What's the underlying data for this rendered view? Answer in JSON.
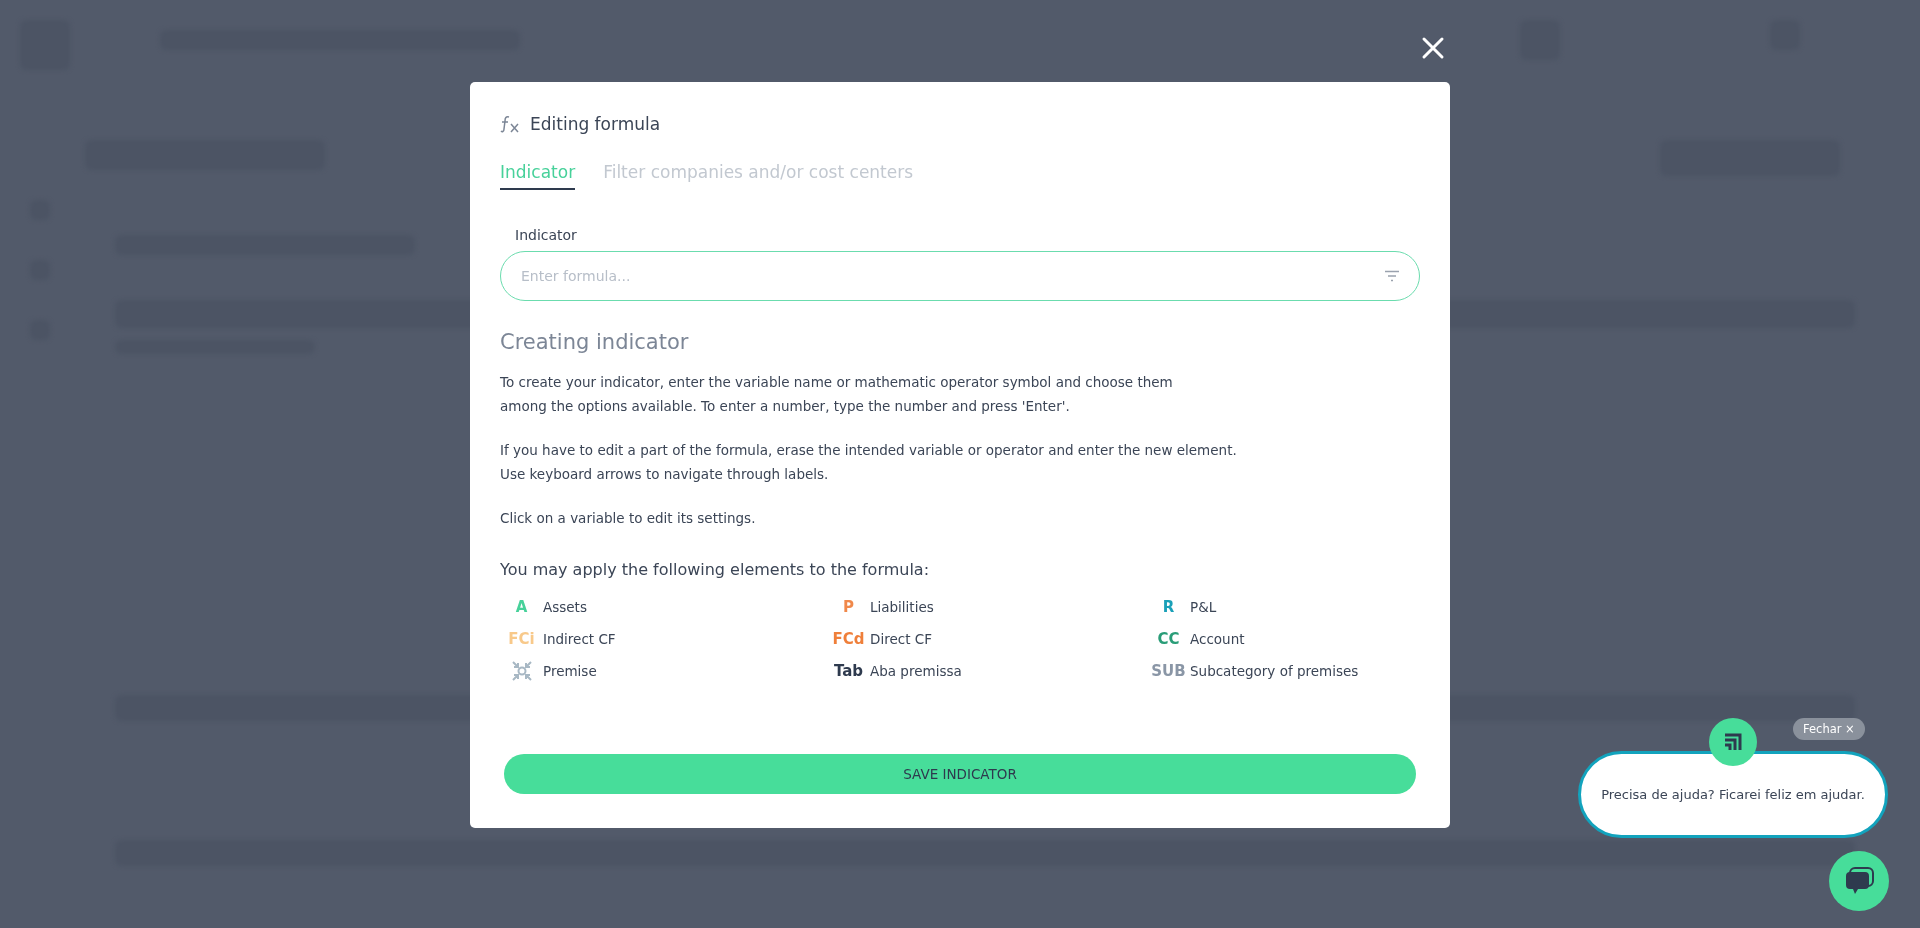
{
  "dialog": {
    "title": "Editing formula",
    "tabs": [
      {
        "label": "Indicator",
        "selected": true
      },
      {
        "label": "Filter companies and/or cost centers",
        "selected": false
      }
    ],
    "field": {
      "label": "Indicator",
      "placeholder": "Enter formula..."
    },
    "heading": "Creating indicator",
    "paragraphs": [
      [
        "To create your indicator, enter the variable name or mathematic operator symbol and choose them",
        "among the options available. To enter a number, type the number and press 'Enter'."
      ],
      [
        "If you have to edit a part of the formula, erase the intended variable or operator and enter the new element.",
        "Use keyboard arrows to navigate through labels."
      ],
      [
        "Click on a variable to edit its settings."
      ]
    ],
    "elements_title": "You may apply the following elements to the formula:",
    "elements": [
      {
        "kind": "text",
        "symbol": "A",
        "label": "Assets",
        "color": "#47d19a"
      },
      {
        "kind": "text",
        "symbol": "P",
        "label": "Liabilities",
        "color": "#f0884a"
      },
      {
        "kind": "text",
        "symbol": "R",
        "label": "P&L",
        "color": "#1aa0b8"
      },
      {
        "kind": "text",
        "symbol": "FCi",
        "label": "Indirect CF",
        "color": "#f8c98a"
      },
      {
        "kind": "text",
        "symbol": "FCd",
        "label": "Direct CF",
        "color": "#ef7f3a"
      },
      {
        "kind": "text",
        "symbol": "CC",
        "label": "Account",
        "color": "#2a9d78"
      },
      {
        "kind": "icon",
        "label": "Premise",
        "color": "#a8b8c4"
      },
      {
        "kind": "text",
        "symbol": "Tab",
        "label": "Aba premissa",
        "color": "#2e3a4e"
      },
      {
        "kind": "text",
        "symbol": "SUB",
        "label": "Subcategory of premises",
        "color": "#8a96a6"
      }
    ],
    "save_button": "SAVE INDICATOR"
  },
  "chat": {
    "message": "Precisa de ajuda? Ficarei feliz em ajudar.",
    "close_label": "Fechar ×"
  }
}
